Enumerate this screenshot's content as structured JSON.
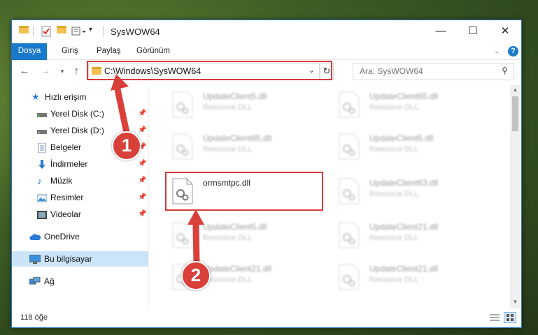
{
  "window": {
    "title": "SysWOW64",
    "controls": {
      "minimize": "—",
      "maximize": "☐",
      "close": "✕"
    }
  },
  "ribbon": {
    "tabs": [
      "Dosya",
      "Giriş",
      "Paylaş",
      "Görünüm"
    ],
    "help": "?"
  },
  "address": {
    "path": "C:\\Windows\\SysWOW64",
    "search_placeholder": "Ara: SysWOW64"
  },
  "navpane": {
    "items": [
      {
        "label": "Hızlı erişim",
        "icon": "star-icon",
        "pinned": false
      },
      {
        "label": "Yerel Disk (C:)",
        "icon": "drive-icon",
        "pinned": true
      },
      {
        "label": "Yerel Disk (D:)",
        "icon": "drive-icon",
        "pinned": true
      },
      {
        "label": "Belgeler",
        "icon": "documents-icon",
        "pinned": true
      },
      {
        "label": "İndirmeler",
        "icon": "download-icon",
        "pinned": true
      },
      {
        "label": "Müzik",
        "icon": "music-icon",
        "pinned": true
      },
      {
        "label": "Resimler",
        "icon": "pictures-icon",
        "pinned": true
      },
      {
        "label": "Videolar",
        "icon": "videos-icon",
        "pinned": true
      },
      {
        "label": "OneDrive",
        "icon": "cloud-icon",
        "pinned": false
      },
      {
        "label": "Bu bilgisayar",
        "icon": "computer-icon",
        "pinned": false
      },
      {
        "label": "Ağ",
        "icon": "network-icon",
        "pinned": false
      }
    ]
  },
  "files": [
    {
      "name": "UpdateClient5.dll",
      "type": "Resource DLL",
      "blurred": true
    },
    {
      "name": "UpdateClient65.dll",
      "type": "Resource DLL",
      "blurred": true
    },
    {
      "name": "UpdateClient65.dll",
      "type": "Resource DLL",
      "blurred": true
    },
    {
      "name": "UpdateClient5.dll",
      "type": "Resource DLL",
      "blurred": true
    },
    {
      "name": "ormsmtpc.dll",
      "type": "",
      "blurred": false
    },
    {
      "name": "UpdateClient63.dll",
      "type": "Resource DLL",
      "blurred": true
    },
    {
      "name": "UpdateClient5.dll",
      "type": "Resource DLL",
      "blurred": true
    },
    {
      "name": "UpdateClient21.dll",
      "type": "Resource DLL",
      "blurred": true
    },
    {
      "name": "UpdateClient21.dll",
      "type": "Resource DLL",
      "blurred": true
    },
    {
      "name": "UpdateClient21.dll",
      "type": "Resource DLL",
      "blurred": true
    }
  ],
  "status": {
    "item_count": "118 öğe"
  },
  "callouts": [
    "1",
    "2"
  ],
  "colors": {
    "accent": "#1979ca",
    "highlight": "#d63b3b",
    "folder": "#f2c24f"
  }
}
